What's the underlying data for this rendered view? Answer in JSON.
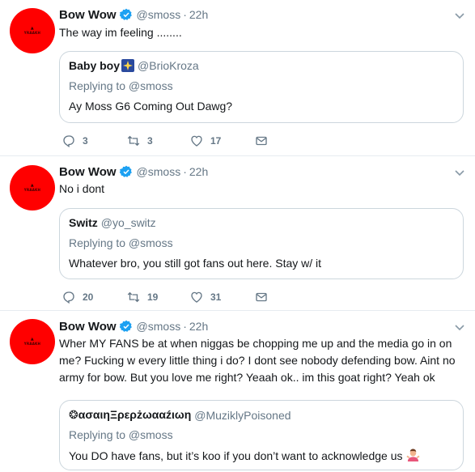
{
  "colors": {
    "avatar": "#ff0000",
    "verified": "#1da1f2",
    "muted": "#657786",
    "border": "#e6ecf0"
  },
  "tweets": [
    {
      "author": "Bow Wow",
      "handle": "@smoss",
      "time": "22h",
      "text": "The way im feeling ........",
      "quote": {
        "author": "Baby boy",
        "author_icon": "sparkle-emoji-icon",
        "handle": "@BrioKroza",
        "replying_to": "Replying to @smoss",
        "text": "Ay Moss G6 Coming Out Dawg?"
      },
      "replies": "3",
      "retweets": "3",
      "likes": "17"
    },
    {
      "author": "Bow Wow",
      "handle": "@smoss",
      "time": "22h",
      "text": "No i dont",
      "quote": {
        "author": "Switz",
        "handle": "@yo_switz",
        "replying_to": "Replying to @smoss",
        "text": "Whatever bro, you still got fans out here. Stay w/ it"
      },
      "replies": "20",
      "retweets": "19",
      "likes": "31"
    },
    {
      "author": "Bow Wow",
      "handle": "@smoss",
      "time": "22h",
      "text": "Wher MY FANS be at when niggas be chopping me up and the media go in on me? Fucking w every little thing i do? I dont see nobody defending bow. Aint no army for bow. But you love me right? Yeaah ok.. im this goat right? Yeah ok",
      "quote": {
        "author": "❂ασαιηΞρερżωααźιωη",
        "handle": "@MuziklyPoisoned",
        "replying_to": "Replying to @smoss",
        "text": "You DO have fans, but it’s koo if you don’t want to acknowledge us",
        "text_icon": "person-shrugging-emoji-icon"
      }
    }
  ]
}
